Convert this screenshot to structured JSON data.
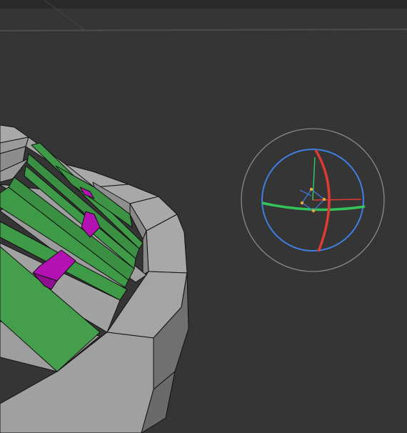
{
  "viewport": {
    "background": "#353535",
    "header_strip_color": "#2a2a2a",
    "grid_line_color": "#4a4a4a"
  },
  "mesh": {
    "face_colors": {
      "gray_light": "#a6a6a6",
      "gray_mid": "#8f8f8f",
      "gray_dark": "#6e6e6e",
      "green": "#3f9a47",
      "green_dark": "#2f7a37",
      "selected": "#b312b3",
      "edge": "#111111"
    }
  },
  "gizmo": {
    "icon": "rotate-gizmo-icon",
    "outer_ring_color": "#8a8a8a",
    "view_ring_color": "#3f7fe0",
    "x_axis_color": "#e03b32",
    "y_axis_color": "#33c45a",
    "pivot_color": "#e8a83a"
  }
}
